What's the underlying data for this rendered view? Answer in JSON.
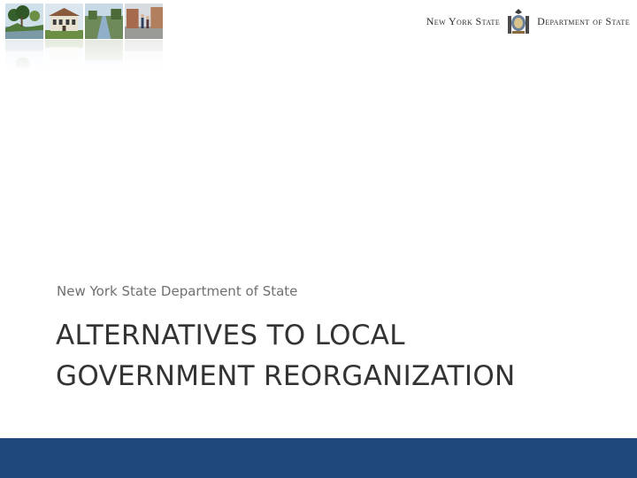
{
  "header": {
    "photos": [
      "lakeside-trees-photo",
      "town-hall-photo",
      "canal-photo",
      "main-street-photo"
    ],
    "logo_left": "New York State",
    "logo_right": "Department of State",
    "seal_icon": "nys-seal-icon"
  },
  "slide": {
    "subtitle": "New York State Department of State",
    "title_line1": "ALTERNATIVES TO LOCAL",
    "title_line2": "GOVERNMENT REORGANIZATION"
  },
  "footer": {
    "bar_color": "#1f497d"
  }
}
